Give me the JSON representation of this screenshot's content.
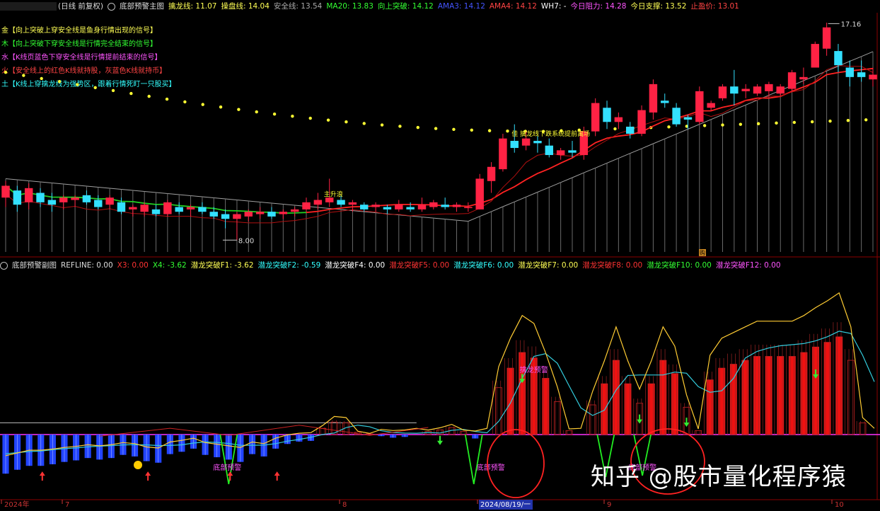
{
  "top_bar": {
    "period": "(日线 前复权)",
    "indicator_name": "底部预警主图",
    "items": [
      {
        "label": "擒龙线:",
        "value": "11.07",
        "color": "#ffff55"
      },
      {
        "label": "操盘线:",
        "value": "14.04",
        "color": "#ffff55"
      },
      {
        "label": "安全线:",
        "value": "13.54",
        "color": "#aaaaaa"
      },
      {
        "label": "MA20:",
        "value": "13.83",
        "color": "#33ff33"
      },
      {
        "label": "向上突破:",
        "value": "14.12",
        "color": "#33ff33"
      },
      {
        "label": "AMA3:",
        "value": "14.12",
        "color": "#4455ff"
      },
      {
        "label": "AMA4:",
        "value": "14.12",
        "color": "#ff4444"
      },
      {
        "label": "WH7:",
        "value": "-",
        "color": "#ffffff"
      },
      {
        "label": "今日阻力:",
        "value": "14.28",
        "color": "#ff55ff"
      },
      {
        "label": "今日支撑:",
        "value": "13.52",
        "color": "#ffff55"
      },
      {
        "label": "止盈价:",
        "value": "13.01",
        "color": "#ff4444"
      }
    ]
  },
  "legend": [
    {
      "text": "金【向上突破上穿安全线是鱼身行情出现的信号】",
      "color": "#ffff55"
    },
    {
      "text": "木【向上突破下穿安全线是行情完全结束的信号】",
      "color": "#33ff33"
    },
    {
      "text": "水【K线页蓝色下穿安全线是行情提前结束的信号】",
      "color": "#ff55ff"
    },
    {
      "text": "火【安全线上的红色K线就持股，灰蓝色K线就持币】",
      "color": "#ff4444"
    },
    {
      "text": "土【K线上穿擒龙线为强势区，跟着行情死盯一只股买】",
      "color": "#33ffff"
    }
  ],
  "main_annotations": {
    "high_price": "17.16",
    "low_price": "8.00",
    "label_zhuli": "主升浪",
    "label_dragon": "佳  擒龙线下跌系统提前离场",
    "marker_label": "购"
  },
  "mid_bar": {
    "indicator_name": "底部预警副图",
    "items": [
      {
        "label": "REFLINE:",
        "value": "0.00",
        "color": "#dddddd"
      },
      {
        "label": "X3:",
        "value": "0.00",
        "color": "#ff3333"
      },
      {
        "label": "X4:",
        "value": "-3.62",
        "color": "#33ff33"
      },
      {
        "label": "潜龙突破F1:",
        "value": "-3.62",
        "color": "#ffff55"
      },
      {
        "label": "潜龙突破F2:",
        "value": "-0.59",
        "color": "#33ffff"
      },
      {
        "label": "潜龙突破F4:",
        "value": "0.00",
        "color": "#ffffff"
      },
      {
        "label": "潜龙突破F5:",
        "value": "0.00",
        "color": "#ff3333"
      },
      {
        "label": "潜龙突破F6:",
        "value": "0.00",
        "color": "#33ffff"
      },
      {
        "label": "潜龙突破F7:",
        "value": "0.00",
        "color": "#ffff55"
      },
      {
        "label": "潜龙突破F8:",
        "value": "0.00",
        "color": "#ff3333"
      },
      {
        "label": "潜龙突破F10:",
        "value": "0.00",
        "color": "#33ff33"
      },
      {
        "label": "潜龙突破F12:",
        "value": "0.00",
        "color": "#ff55ff"
      }
    ]
  },
  "sub_annotations": {
    "bottom_warning_1": "底部预警",
    "bottom_warning_2": "底部预警",
    "bottom_warning_3": "底部预警",
    "dragon_warning": "擒龙预警"
  },
  "x_axis": {
    "labels": [
      "2024年",
      "7",
      "8",
      "2024/08/19/一",
      "9",
      "10"
    ]
  },
  "watermark": "知乎 @股市量化程序猿",
  "chart_data": [
    {
      "type": "candlestick",
      "title": "底部预警主图",
      "period": "日线 前复权",
      "ylim": [
        7.5,
        17.5
      ],
      "annotations": [
        {
          "label": "high",
          "value": 17.16
        },
        {
          "label": "low",
          "value": 8.0
        }
      ],
      "candles": [
        [
          9.8,
          10.5,
          9.4,
          10.3
        ],
        [
          10.1,
          10.3,
          9.2,
          9.5
        ],
        [
          9.6,
          10.4,
          9.3,
          10.2
        ],
        [
          10.0,
          10.2,
          9.4,
          9.6
        ],
        [
          9.7,
          10.0,
          9.2,
          9.5
        ],
        [
          9.6,
          9.9,
          9.3,
          9.8
        ],
        [
          9.7,
          9.9,
          9.4,
          9.8
        ],
        [
          9.9,
          10.1,
          9.5,
          9.6
        ],
        [
          9.7,
          9.9,
          9.3,
          9.4
        ],
        [
          9.5,
          9.9,
          9.3,
          9.8
        ],
        [
          9.6,
          9.8,
          9.1,
          9.2
        ],
        [
          9.3,
          9.5,
          9.0,
          9.4
        ],
        [
          9.2,
          9.6,
          9.0,
          9.5
        ],
        [
          9.3,
          9.5,
          9.0,
          9.1
        ],
        [
          9.1,
          9.7,
          9.0,
          9.6
        ],
        [
          9.4,
          9.6,
          9.1,
          9.2
        ],
        [
          9.3,
          9.5,
          9.0,
          9.4
        ],
        [
          9.4,
          9.6,
          9.1,
          9.2
        ],
        [
          9.2,
          9.4,
          8.9,
          9.0
        ],
        [
          9.1,
          9.3,
          8.5,
          8.9
        ],
        [
          8.9,
          9.2,
          8.0,
          9.1
        ],
        [
          9.0,
          9.3,
          8.8,
          9.2
        ],
        [
          9.1,
          9.4,
          8.9,
          9.2
        ],
        [
          9.2,
          9.4,
          8.9,
          9.0
        ],
        [
          9.1,
          9.3,
          8.9,
          9.2
        ],
        [
          9.2,
          9.4,
          9.0,
          9.3
        ],
        [
          9.3,
          9.8,
          9.2,
          9.6
        ],
        [
          9.5,
          10.0,
          9.3,
          9.7
        ],
        [
          9.6,
          10.6,
          9.4,
          9.8
        ],
        [
          9.7,
          9.9,
          9.4,
          9.5
        ],
        [
          9.5,
          9.7,
          9.2,
          9.6
        ],
        [
          9.5,
          9.6,
          9.2,
          9.3
        ],
        [
          9.4,
          9.6,
          9.2,
          9.5
        ],
        [
          9.4,
          9.5,
          9.1,
          9.3
        ],
        [
          9.3,
          9.7,
          9.2,
          9.5
        ],
        [
          9.4,
          9.6,
          9.2,
          9.3
        ],
        [
          9.3,
          9.8,
          9.2,
          9.5
        ],
        [
          9.4,
          9.7,
          9.3,
          9.6
        ],
        [
          9.5,
          9.8,
          9.3,
          9.4
        ],
        [
          9.4,
          9.6,
          9.2,
          9.5
        ],
        [
          9.4,
          9.6,
          9.2,
          9.4
        ],
        [
          9.3,
          10.8,
          9.3,
          10.6
        ],
        [
          10.5,
          11.3,
          10.0,
          11.1
        ],
        [
          11.0,
          12.5,
          10.9,
          12.3
        ],
        [
          12.2,
          12.9,
          11.7,
          11.9
        ],
        [
          12.0,
          12.6,
          11.8,
          12.3
        ],
        [
          12.2,
          12.4,
          11.7,
          12.1
        ],
        [
          12.0,
          12.3,
          11.5,
          11.6
        ],
        [
          11.6,
          11.9,
          11.4,
          11.8
        ],
        [
          11.8,
          12.2,
          11.5,
          11.7
        ],
        [
          11.6,
          12.8,
          11.4,
          12.6
        ],
        [
          12.6,
          14.0,
          12.4,
          13.8
        ],
        [
          13.6,
          13.9,
          12.7,
          13.0
        ],
        [
          13.0,
          13.4,
          12.7,
          13.2
        ],
        [
          12.8,
          13.0,
          12.3,
          12.5
        ],
        [
          12.5,
          13.7,
          12.4,
          13.5
        ],
        [
          13.4,
          14.8,
          13.1,
          14.6
        ],
        [
          13.9,
          14.2,
          13.6,
          13.8
        ],
        [
          13.6,
          13.8,
          12.8,
          12.9
        ],
        [
          13.2,
          13.3,
          12.7,
          13.1
        ],
        [
          13.0,
          14.5,
          12.9,
          14.3
        ],
        [
          13.6,
          13.9,
          13.5,
          13.8
        ],
        [
          14.0,
          14.6,
          13.9,
          14.5
        ],
        [
          14.5,
          15.2,
          13.7,
          14.2
        ],
        [
          14.3,
          14.6,
          14.0,
          14.4
        ],
        [
          14.2,
          14.6,
          14.1,
          14.5
        ],
        [
          14.3,
          14.7,
          14.1,
          14.6
        ],
        [
          14.2,
          14.6,
          14.1,
          14.5
        ],
        [
          14.4,
          15.2,
          14.3,
          15.1
        ],
        [
          14.8,
          15.3,
          14.6,
          14.9
        ],
        [
          15.3,
          16.4,
          15.3,
          16.3
        ],
        [
          16.1,
          17.2,
          15.8,
          17.0
        ],
        [
          16.0,
          16.3,
          15.1,
          15.4
        ],
        [
          15.3,
          15.6,
          14.5,
          14.9
        ],
        [
          15.1,
          15.6,
          14.7,
          14.9
        ],
        [
          14.8,
          15.3,
          14.5,
          15.0
        ]
      ],
      "dragon_line_dots": {
        "start": 15.1,
        "min": 12.6,
        "end": 13.1
      }
    },
    {
      "type": "bar",
      "title": "底部预警副图",
      "ylim": [
        -7,
        21
      ],
      "values": [
        -5,
        -4.5,
        -4,
        -4,
        -3.8,
        -3.5,
        -3.3,
        -3.0,
        -3.2,
        -3.0,
        -2.6,
        -2.8,
        -3.4,
        -3.6,
        -2.5,
        -2.2,
        -1.8,
        -2.6,
        -2.9,
        -3.2,
        -3.5,
        -2.5,
        -2.8,
        -1.8,
        -1.2,
        -0.9,
        -0.8,
        0.8,
        1.6,
        1.5,
        0.3,
        0.1,
        -0.2,
        -0.4,
        -0.3,
        0,
        0.4,
        0.6,
        0.9,
        0.4,
        -0.5,
        0,
        6,
        8.5,
        10.5,
        9.8,
        7.2,
        4.2,
        0.5,
        0,
        3.8,
        6.5,
        9.5,
        6.5,
        4,
        6.5,
        9.5,
        7.8,
        3.5,
        0.5,
        7,
        8.5,
        9.0,
        9.5,
        10,
        10,
        10,
        10,
        10.5,
        11.2,
        11.8,
        12.5,
        9.5,
        1.5,
        0
      ]
    }
  ]
}
